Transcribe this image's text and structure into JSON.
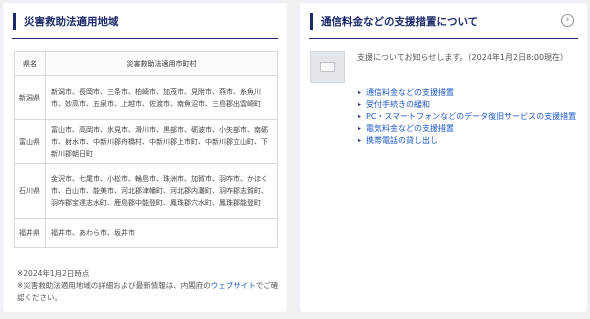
{
  "left_card": {
    "title": "災害救助法適用地域",
    "table": {
      "headers": [
        "県名",
        "災害救助法適用市町村"
      ],
      "rows": [
        {
          "pref": "新潟県",
          "cities": "新潟市、長岡市、三条市、柏崎市、加茂市、見附市、燕市、糸魚川市、妙高市、五泉市、上越市、佐渡市、南魚沼市、三島郡出雲崎町"
        },
        {
          "pref": "富山県",
          "cities": "富山市、高岡市、氷見市、滑川市、黒部市、砺波市、小矢部市、南砺市、射水市、中新川郡舟橋村、中新川郡上市町、中新川郡立山町、下新川郡朝日町"
        },
        {
          "pref": "石川県",
          "cities": "金沢市、七尾市、小松市、輪島市、珠洲市、加賀市、羽咋市、かほく市、白山市、能美市、河北郡津幡町、河北郡内灘町、羽咋郡志賀町、羽咋郡宝達志水町、鹿島郡中能登町、鳳珠郡穴水町、鳳珠郡能登町"
        },
        {
          "pref": "福井県",
          "cities": "福井市、あわら市、坂井市"
        }
      ]
    },
    "note_date": "※2024年1月2日時点",
    "note_prefix": "※災害救助法適用地域の詳細および最新情報は、内閣府の",
    "note_link": "ウェブサイト",
    "note_suffix": "でご確認ください。"
  },
  "right_card": {
    "title": "通信料金などの支援措置について",
    "chevron": "›",
    "info": "支援についてお知らせします。（2024年1月2日8:00現在）",
    "links": [
      "通信料金などの支援措置",
      "受付手続きの緩和",
      "PC・スマートフォンなどのデータ復旧サービスの支援措置",
      "電気料金などの支援措置",
      "携帯電話の貸し出し"
    ],
    "bullet": "▸"
  }
}
